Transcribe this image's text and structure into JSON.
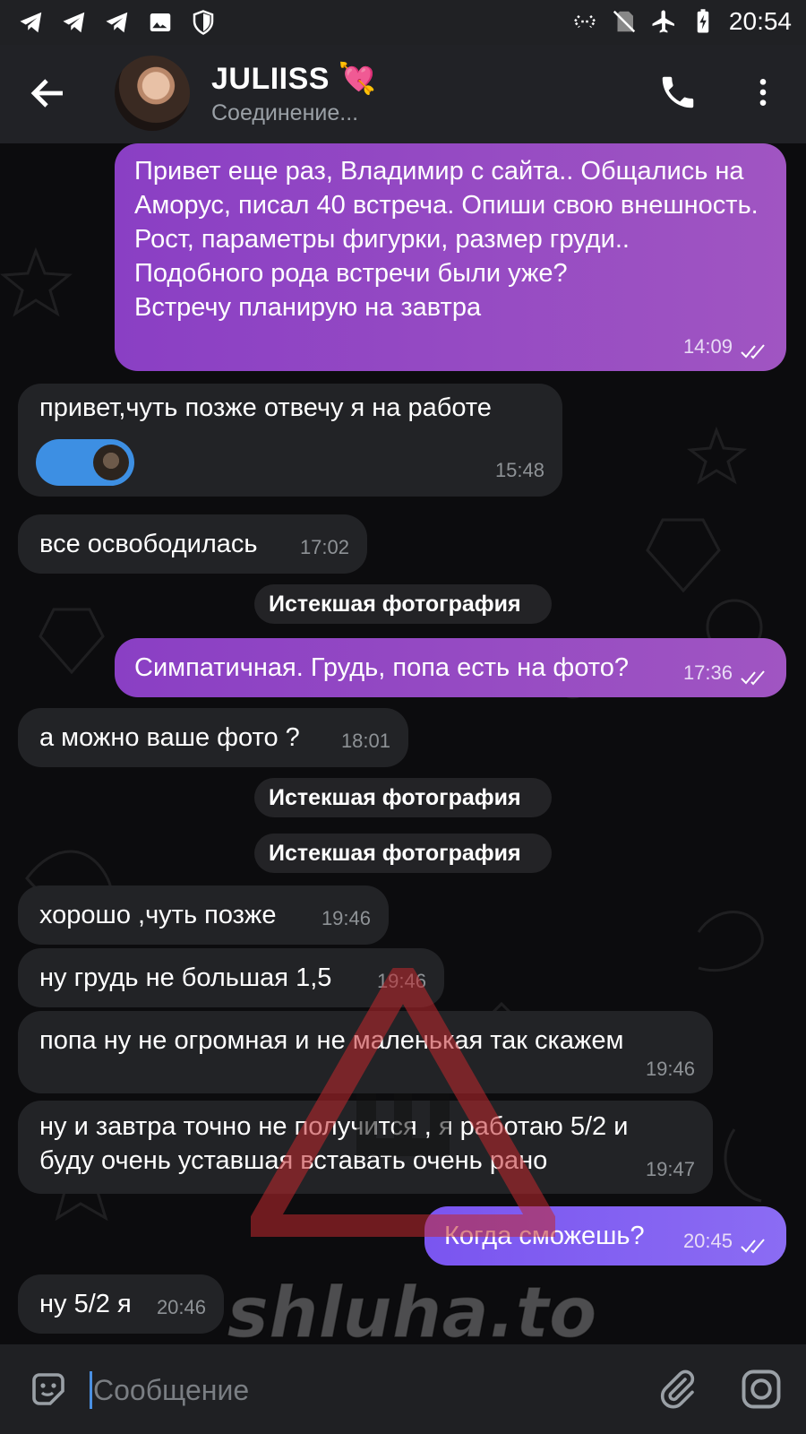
{
  "status_bar": {
    "time": "20:54"
  },
  "header": {
    "contact_name": "JULIISS 💘",
    "status": "Соединение..."
  },
  "messages": [
    {
      "dir": "out",
      "text": "Привет еще раз, Владимир с сайта.. Общались на Аморус, писал 40 встреча. Опиши свою внешность. Рост, параметры фигурки, размер груди..\nПодобного рода встречи были уже?\nВстречу планирую на завтра",
      "time": "14:09"
    },
    {
      "dir": "in",
      "text": "привет,чуть позже отвечу я на работе",
      "time": "15:48",
      "has_voice": true
    },
    {
      "dir": "in",
      "text": "все освободилась",
      "time": "17:02"
    },
    {
      "dir": "service",
      "text": "Истекшая фотография"
    },
    {
      "dir": "out",
      "text": "Симпатичная. Грудь, попа есть на фото?",
      "time": "17:36"
    },
    {
      "dir": "in",
      "text": "а можно ваше фото ?",
      "time": "18:01"
    },
    {
      "dir": "service",
      "text": "Истекшая фотография"
    },
    {
      "dir": "service",
      "text": "Истекшая фотография"
    },
    {
      "dir": "in",
      "text": "хорошо ,чуть позже",
      "time": "19:46"
    },
    {
      "dir": "in",
      "text": "ну грудь не большая 1,5",
      "time": "19:46"
    },
    {
      "dir": "in",
      "text": "попа ну не огромная и не маленькая так скажем",
      "time": "19:46"
    },
    {
      "dir": "in",
      "text": "ну и завтра точно не получится , я работаю 5/2 и буду очень уставшая вставать очень рано",
      "time": "19:47"
    },
    {
      "dir": "out",
      "text": "Когда сможешь?",
      "time": "20:45"
    },
    {
      "dir": "in",
      "text": "ну 5/2 я",
      "time": "20:46"
    }
  ],
  "watermark": {
    "text": "shluha.to"
  },
  "input": {
    "placeholder": "Сообщение"
  },
  "colors": {
    "outgoing": "#9a4fc3",
    "incoming": "#222326",
    "accent": "#3d8fe3",
    "header": "#212226"
  },
  "icons": [
    "telegram-icon",
    "image-icon",
    "shield-icon",
    "back-arrow-icon",
    "phone-icon",
    "more-vert-icon",
    "sticker-icon",
    "paperclip-icon",
    "camera-icon"
  ]
}
